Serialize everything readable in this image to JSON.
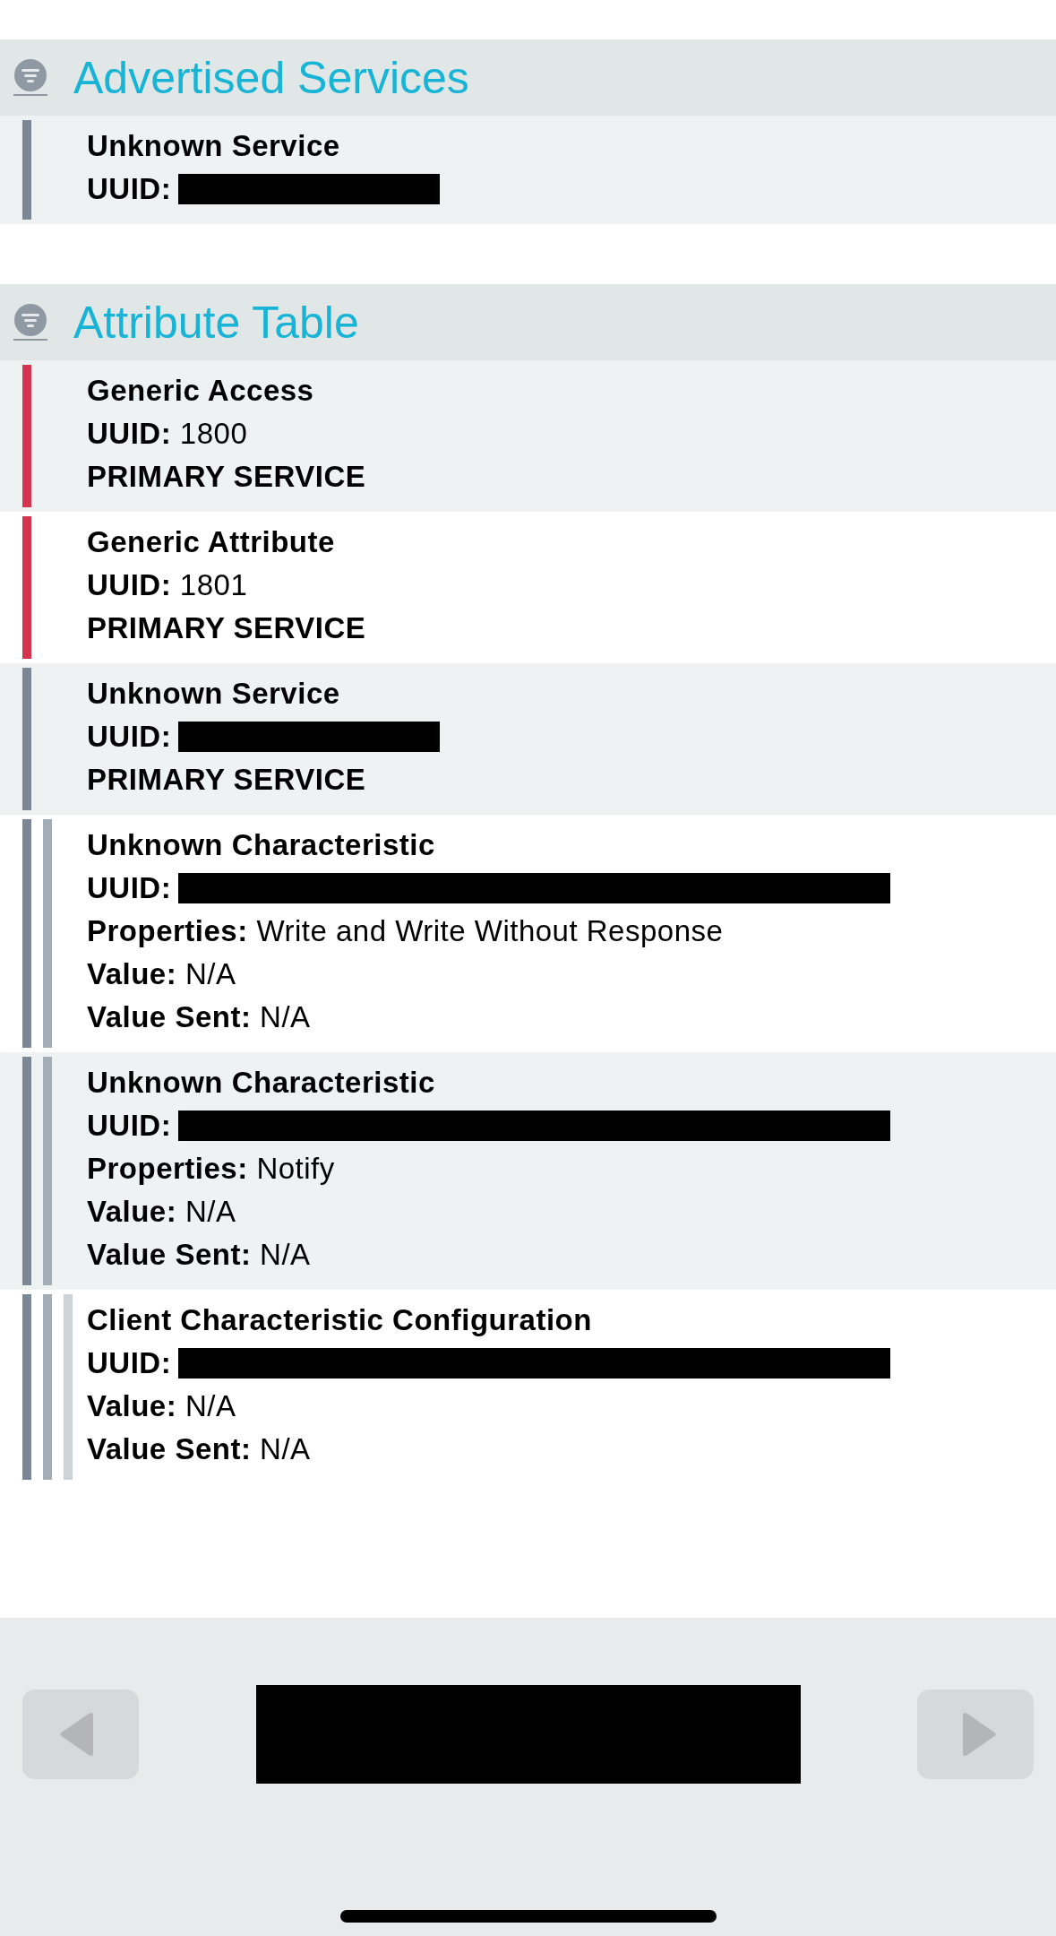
{
  "sections": [
    {
      "title": "Advertised Services",
      "items": [
        {
          "name": "Unknown Service",
          "color": "#7b8794",
          "fields": [
            {
              "label": "UUID:",
              "redacted": true
            }
          ]
        }
      ]
    },
    {
      "title": "Attribute Table",
      "items": [
        {
          "name": "Generic Access",
          "color": "#d4344d",
          "fields": [
            {
              "label": "UUID:",
              "value": "1800"
            }
          ],
          "type": "PRIMARY SERVICE"
        },
        {
          "name": "Generic Attribute",
          "color": "#d4344d",
          "fields": [
            {
              "label": "UUID:",
              "value": "1801"
            }
          ],
          "type": "PRIMARY SERVICE"
        },
        {
          "name": "Unknown Service",
          "color": "#7b8794",
          "fields": [
            {
              "label": "UUID:",
              "redacted": true
            }
          ],
          "type": "PRIMARY SERVICE",
          "children": [
            {
              "name": "Unknown Characteristic",
              "color": "#a3adb6",
              "fields": [
                {
                  "label": "UUID:",
                  "redacted": true
                },
                {
                  "label": "Properties:",
                  "value": "Write and Write Without Response"
                },
                {
                  "label": "Value:",
                  "value": "N/A"
                },
                {
                  "label": "Value Sent:",
                  "value": "N/A"
                }
              ]
            },
            {
              "name": "Unknown Characteristic",
              "color": "#a3adb6",
              "fields": [
                {
                  "label": "UUID:",
                  "redacted": true
                },
                {
                  "label": "Properties:",
                  "value": "Notify"
                },
                {
                  "label": "Value:",
                  "value": "N/A"
                },
                {
                  "label": "Value Sent:",
                  "value": "N/A"
                }
              ],
              "children": [
                {
                  "name": "Client Characteristic Configuration",
                  "color": "#cdd3d8",
                  "fields": [
                    {
                      "label": "UUID:",
                      "redacted": true
                    },
                    {
                      "label": "Value:",
                      "value": "N/A"
                    },
                    {
                      "label": "Value Sent:",
                      "value": "N/A"
                    }
                  ]
                }
              ]
            }
          ]
        }
      ]
    }
  ],
  "toolbar": {
    "title_redacted": true
  }
}
